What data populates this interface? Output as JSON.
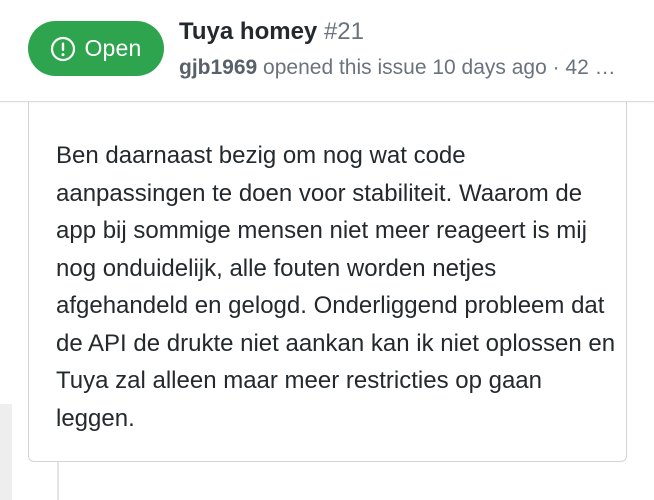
{
  "issue": {
    "state": "Open",
    "state_icon": "issue-opened-icon",
    "title": "Tuya homey",
    "number": "#21",
    "author": "gjb1969",
    "meta": " opened this issue 10 days ago · 42 …"
  },
  "comment": {
    "body": "Ben daarnaast bezig om nog wat code aanpassingen te doen voor stabiliteit. Waarom de app bij sommige mensen niet meer reageert is mij nog onduidelijk, alle fouten worden netjes afgehandeld en gelogd. Onderliggend probleem dat de API de drukte niet aankan kan ik niet oplossen en Tuya zal alleen maar meer restricties op gaan leggen."
  },
  "colors": {
    "open_green": "#2ea44f",
    "text_primary": "#24292e",
    "text_muted": "#6a737d",
    "border": "#d1d5da"
  }
}
